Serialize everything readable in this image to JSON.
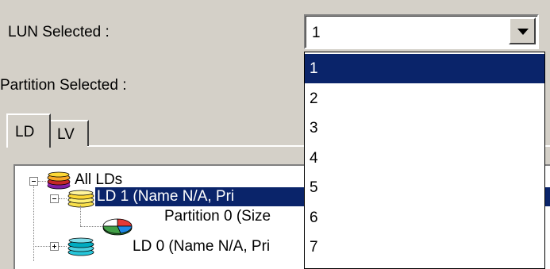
{
  "lun": {
    "label": "LUN Selected :",
    "selected_value": "1",
    "options": [
      "1",
      "2",
      "3",
      "4",
      "5",
      "6",
      "7"
    ],
    "highlighted_index": 0
  },
  "partition": {
    "label": "Partition Selected :"
  },
  "tabs": [
    {
      "label": "LD",
      "active": true
    },
    {
      "label": "LV",
      "active": false
    }
  ],
  "tree": {
    "root": {
      "label": "All LDs",
      "icon": "disk-stack-multicolor-icon"
    },
    "children": [
      {
        "label": "LD 1 (Name N/A, Pri",
        "icon": "disk-stack-yellow-icon",
        "selected": true,
        "expanded": true,
        "children": [
          {
            "label": "Partition 0 (Size",
            "icon": "pie-chart-icon"
          }
        ]
      },
      {
        "label": "LD 0 (Name N/A, Pri",
        "icon": "disk-stack-cyan-icon",
        "selected": false,
        "expanded": false
      }
    ]
  },
  "colors": {
    "background": "#d4d0c8",
    "selection": "#0a246a"
  }
}
